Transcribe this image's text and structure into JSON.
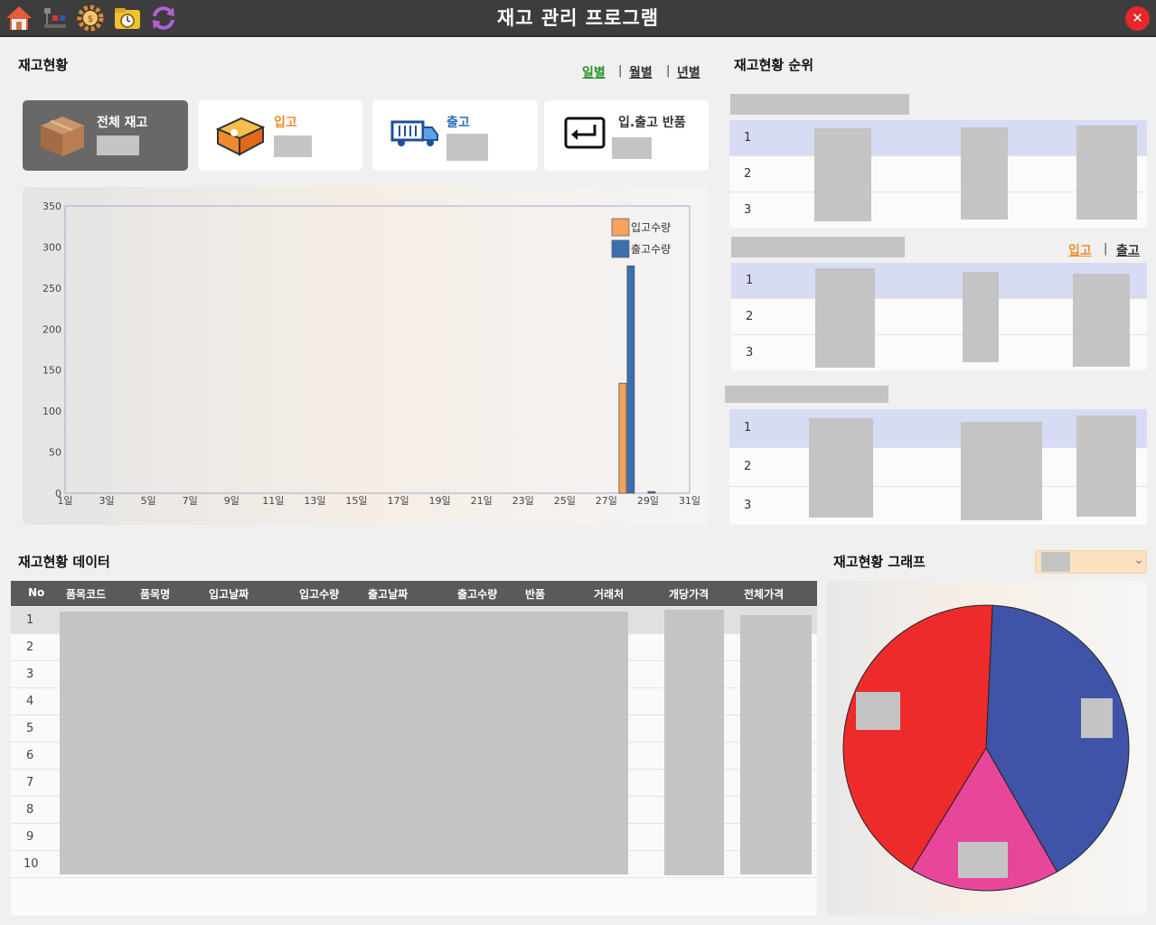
{
  "window": {
    "title": "재고 관리 프로그램",
    "close_label": "✕"
  },
  "toolbar": {
    "icons": [
      "home-icon",
      "hierarchy-icon",
      "gear-money-icon",
      "folder-clock-icon",
      "refresh-icon"
    ]
  },
  "stock_status": {
    "title": "재고현황",
    "periods": [
      {
        "label": "일별",
        "active": true,
        "color": "#23922f"
      },
      {
        "label": "월별",
        "active": false,
        "color": "#333333"
      },
      {
        "label": "년별",
        "active": false,
        "color": "#333333"
      }
    ],
    "cards": [
      {
        "label": "전체 재고",
        "icon": "box-icon",
        "color": "#ffffff"
      },
      {
        "label": "입고",
        "icon": "package-icon",
        "color": "#f08b2a"
      },
      {
        "label": "출고",
        "icon": "truck-icon",
        "color": "#2f6fb5"
      },
      {
        "label": "입.출고 반품",
        "icon": "return-key-icon",
        "color": "#333333"
      }
    ]
  },
  "chart_data": {
    "type": "bar",
    "title": "",
    "x": [
      "1일",
      "3일",
      "5일",
      "7일",
      "9일",
      "11일",
      "13일",
      "15일",
      "17일",
      "19일",
      "21일",
      "23일",
      "25일",
      "27일",
      "29일",
      "31일"
    ],
    "yticks": [
      0,
      50,
      100,
      150,
      200,
      250,
      300,
      350
    ],
    "ylim": [
      0,
      350
    ],
    "xlim": [
      1,
      31
    ],
    "series": [
      {
        "name": "입고수량",
        "color": "#f4a25c",
        "points": [
          [
            28,
            134
          ]
        ]
      },
      {
        "name": "출고수량",
        "color": "#3a6fb0",
        "points": [
          [
            28,
            277
          ],
          [
            29,
            2
          ]
        ]
      }
    ],
    "legend": "top-right",
    "grid": false
  },
  "ranking": {
    "title": "재고현황 순위",
    "inout_tabs": [
      {
        "label": "입고",
        "color": "#f08b2a"
      },
      {
        "label": "출고",
        "color": "#333333"
      }
    ],
    "rows": [
      "1",
      "2",
      "3"
    ]
  },
  "data_table": {
    "title": "재고현황 데이터",
    "columns": [
      "No",
      "품목코드",
      "품목명",
      "입고날짜",
      "입고수량",
      "출고날짜",
      "출고수량",
      "반품",
      "거래처",
      "개당가격",
      "전체가격"
    ],
    "rows": [
      "1",
      "2",
      "3",
      "4",
      "5",
      "6",
      "7",
      "8",
      "9",
      "10"
    ]
  },
  "graph": {
    "title": "재고현황 그래프",
    "dropdown_arrow": "⌄",
    "pie_data": [
      {
        "color": "#3f54a8",
        "value": 0.41
      },
      {
        "color": "#e8469a",
        "value": 0.17
      },
      {
        "color": "#ee2b2b",
        "value": 0.42
      }
    ]
  }
}
